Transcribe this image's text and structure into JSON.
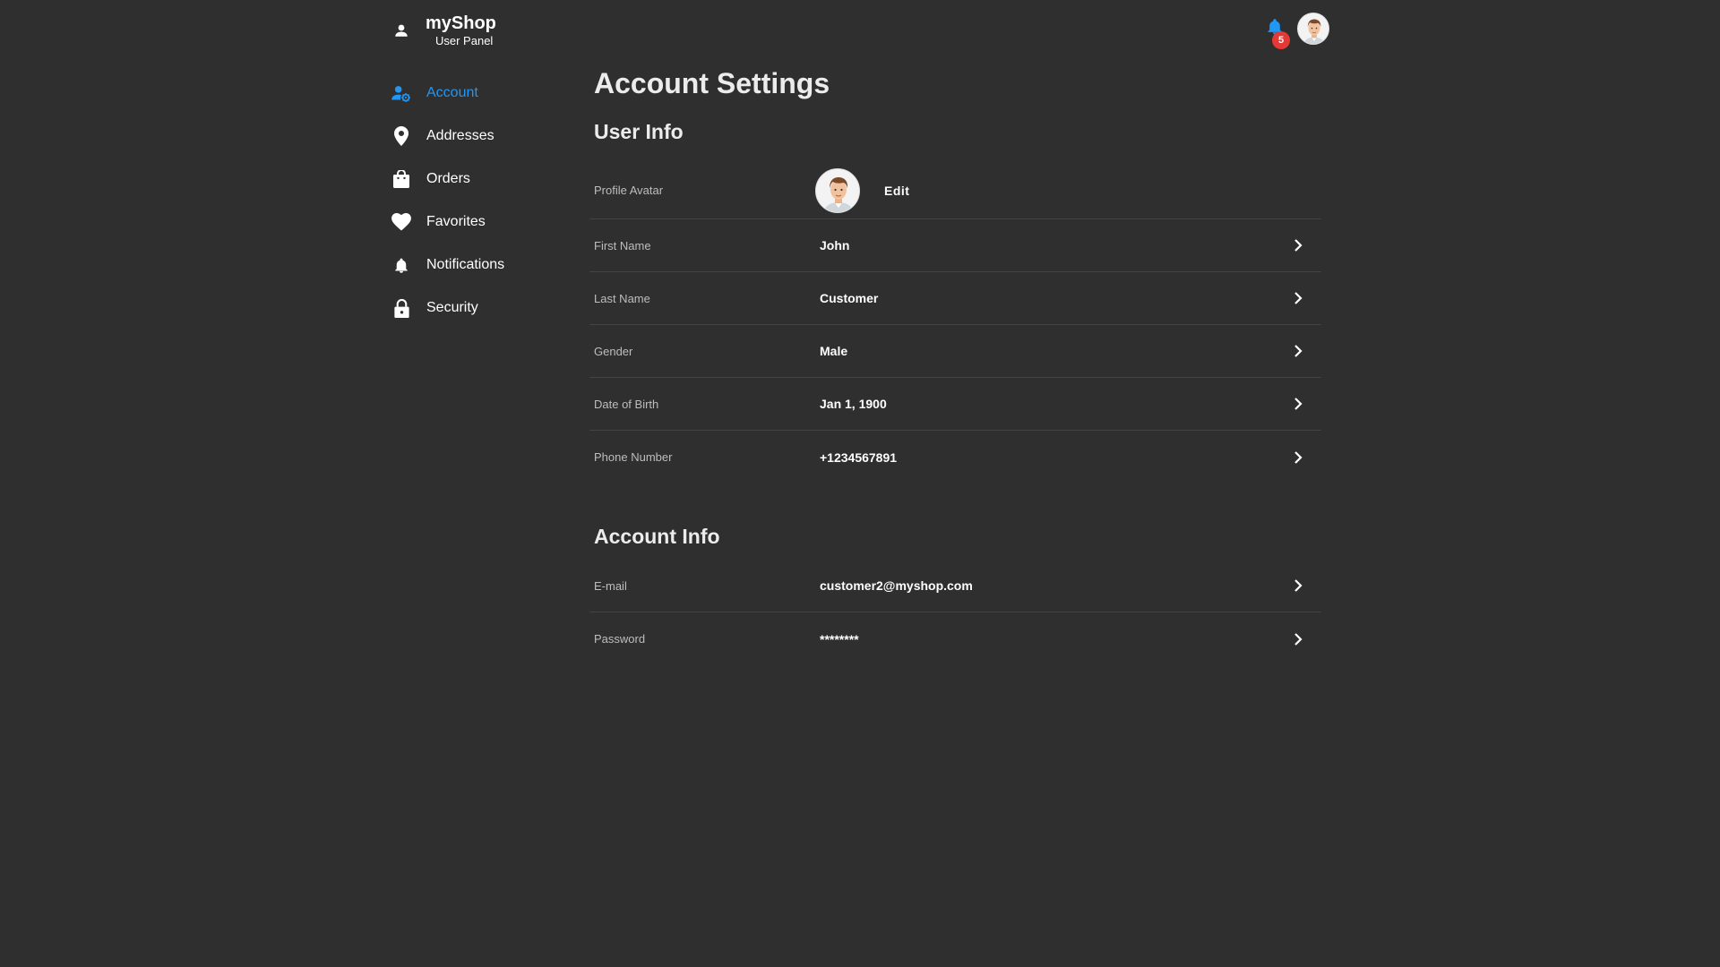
{
  "brand": {
    "title": "myShop",
    "subtitle": "User Panel",
    "icon": "person-icon"
  },
  "header": {
    "notification_count": "5",
    "bell_icon": "bell-icon",
    "bell_color": "#2196f3",
    "badge_color": "#e53935"
  },
  "sidebar": {
    "items": [
      {
        "label": "Account",
        "icon": "account-settings-icon",
        "active": true
      },
      {
        "label": "Addresses",
        "icon": "location-pin-icon",
        "active": false
      },
      {
        "label": "Orders",
        "icon": "shopping-bag-icon",
        "active": false
      },
      {
        "label": "Favorites",
        "icon": "heart-icon",
        "active": false
      },
      {
        "label": "Notifications",
        "icon": "bell-icon",
        "active": false
      },
      {
        "label": "Security",
        "icon": "lock-icon",
        "active": false
      }
    ],
    "active_color": "#2196f3"
  },
  "main": {
    "title": "Account Settings",
    "user_info": {
      "title": "User Info",
      "avatar_label": "Profile Avatar",
      "edit_label": "Edit",
      "fields": [
        {
          "label": "First Name",
          "value": "John"
        },
        {
          "label": "Last Name",
          "value": "Customer"
        },
        {
          "label": "Gender",
          "value": "Male"
        },
        {
          "label": "Date of Birth",
          "value": "Jan 1, 1900"
        },
        {
          "label": "Phone Number",
          "value": "+1234567891"
        }
      ]
    },
    "account_info": {
      "title": "Account Info",
      "fields": [
        {
          "label": "E-mail",
          "value": "customer2@myshop.com"
        },
        {
          "label": "Password",
          "value": "********"
        }
      ]
    }
  }
}
